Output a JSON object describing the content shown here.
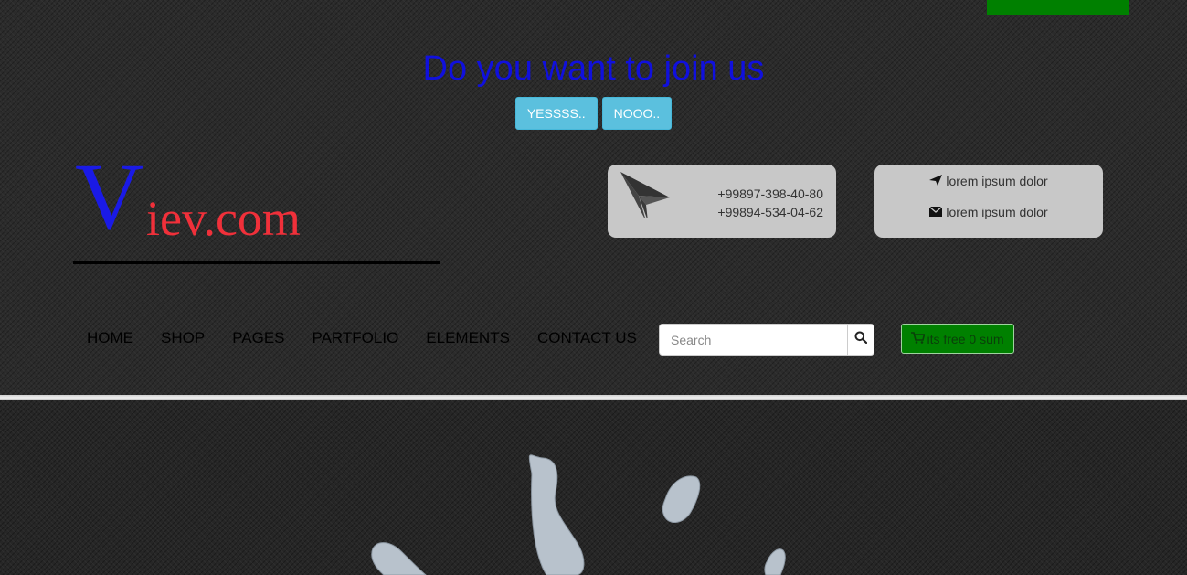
{
  "colors": {
    "top_bar": "#008000",
    "title": "#1010dd",
    "join_button": "#5bc0de",
    "logo_v": "#1a1ae6",
    "logo_rest": "#f0303a",
    "info_box": "#c8c8c8",
    "cart": "#008000",
    "splash": "#b8c2cc"
  },
  "join": {
    "title": "Do you want to join us",
    "yes_label": "YESSSS..",
    "no_label": "NOOO.."
  },
  "logo": {
    "first_letter": "V",
    "rest": "iev.com"
  },
  "contact": {
    "phone_icon": "paper-plane-icon",
    "phones": [
      "+99897-398-40-80",
      "+99894-534-04-62"
    ],
    "lines": [
      {
        "icon": "send-icon",
        "text": "lorem ipsum dolor"
      },
      {
        "icon": "envelope-icon",
        "text": "lorem ipsum dolor"
      }
    ]
  },
  "nav": {
    "items": [
      "HOME",
      "SHOP",
      "PAGES",
      "PARTFOLIO",
      "ELEMENTS",
      "CONTACT US"
    ]
  },
  "search": {
    "placeholder": "Search",
    "icon": "search-icon"
  },
  "cart": {
    "icon": "cart-icon",
    "label": "its free 0 sum"
  }
}
